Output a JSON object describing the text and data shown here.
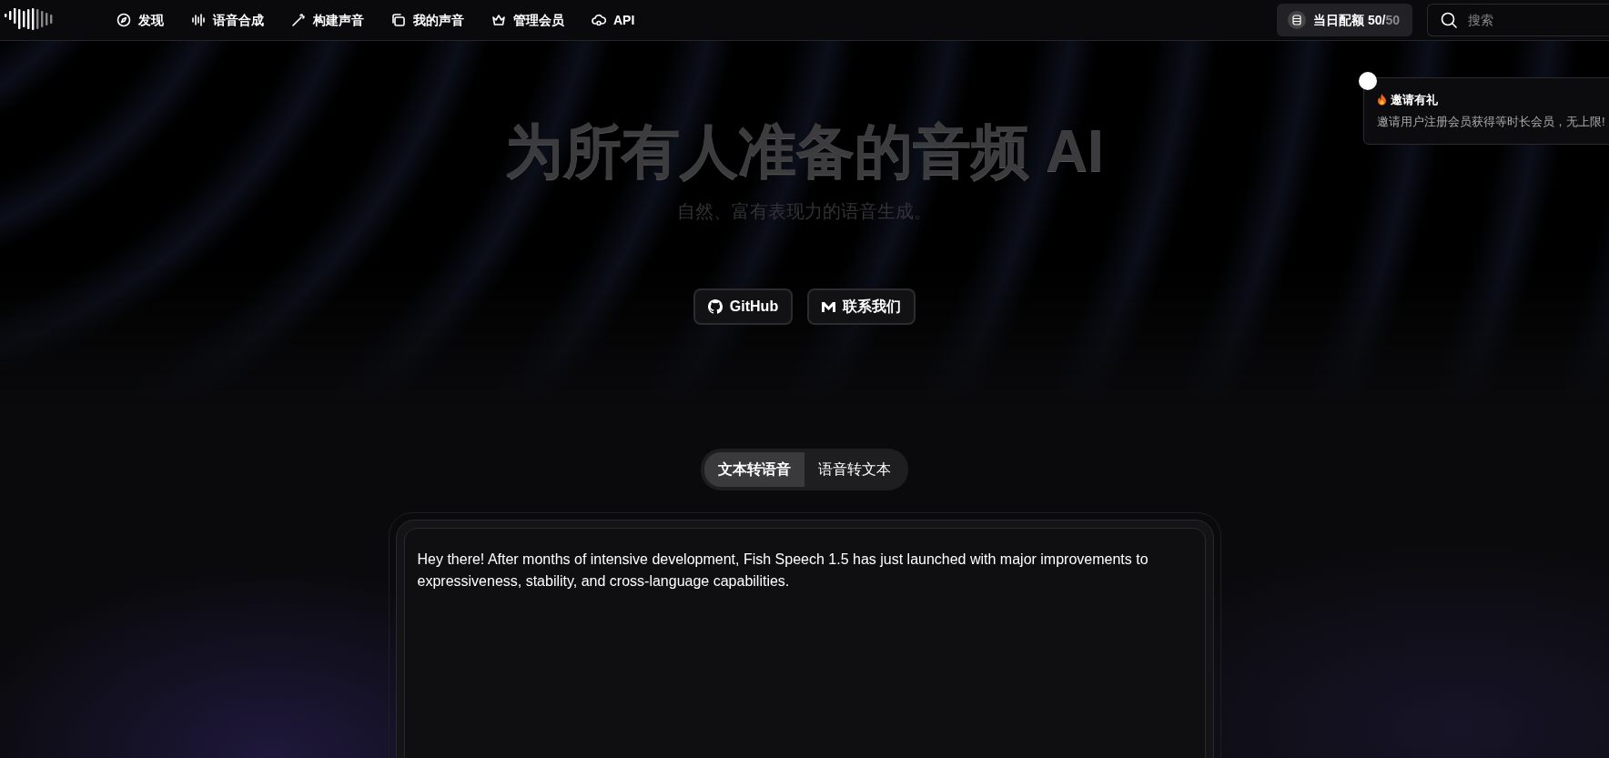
{
  "nav": {
    "items": [
      {
        "label": "发现"
      },
      {
        "label": "语音合成"
      },
      {
        "label": "构建声音"
      },
      {
        "label": "我的声音"
      },
      {
        "label": "管理会员"
      },
      {
        "label": "API"
      }
    ],
    "quota": {
      "label": "当日配额",
      "used": "50/",
      "limit": "50"
    },
    "search": {
      "placeholder": "搜索"
    }
  },
  "notification": {
    "title": "邀请有礼",
    "text": "邀请用户注册会员获得等时长会员，无上限!"
  },
  "hero": {
    "title": "为所有人准备的音频 AI",
    "subtitle": "自然、富有表现力的语音生成。",
    "buttons": [
      {
        "label": "GitHub"
      },
      {
        "label": "联系我们"
      }
    ]
  },
  "tabs": [
    {
      "label": "文本转语音",
      "selected": true
    },
    {
      "label": "语音转文本",
      "selected": false
    }
  ],
  "editor": {
    "text": "Hey there! After months of intensive development, Fish Speech 1.5 has just launched with major improvements to expressiveness, stability, and cross-language capabilities."
  }
}
